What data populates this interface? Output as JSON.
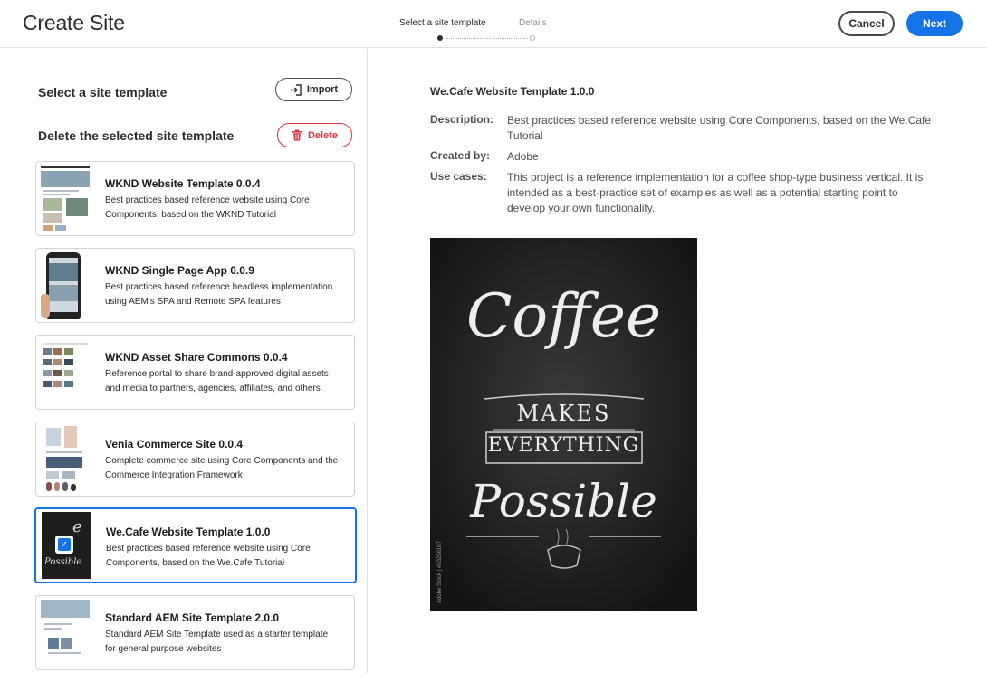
{
  "header": {
    "title": "Create Site",
    "steps": [
      {
        "label": "Select a site template",
        "active": true
      },
      {
        "label": "Details",
        "active": false
      }
    ],
    "cancel_label": "Cancel",
    "next_label": "Next"
  },
  "left": {
    "select_title": "Select a site template",
    "import_label": "Import",
    "delete_title": "Delete the selected site template",
    "delete_label": "Delete",
    "templates": [
      {
        "title": "WKND Website Template 0.0.4",
        "desc": "Best practices based reference website using Core Components, based on the WKND Tutorial",
        "selected": false
      },
      {
        "title": "WKND Single Page App 0.0.9",
        "desc": "Best practices based reference headless implementation using AEM's SPA and Remote SPA features",
        "selected": false
      },
      {
        "title": "WKND Asset Share Commons 0.0.4",
        "desc": "Reference portal to share brand-approved digital assets and media to partners, agencies, affiliates, and others",
        "selected": false
      },
      {
        "title": "Venia Commerce Site 0.0.4",
        "desc": "Complete commerce site using Core Components and the Commerce Integration Framework",
        "selected": false
      },
      {
        "title": "We.Cafe Website Template 1.0.0",
        "desc": "Best practices based reference website using Core Components, based on the We.Cafe Tutorial",
        "selected": true
      },
      {
        "title": "Standard AEM Site Template 2.0.0",
        "desc": "Standard AEM Site Template used as a starter template for general purpose websites",
        "selected": false
      }
    ]
  },
  "detail": {
    "title": "We.Cafe Website Template 1.0.0",
    "description_label": "Description:",
    "description": "Best practices based reference website using Core Components, based on the We.Cafe Tutorial",
    "created_by_label": "Created by:",
    "created_by": "Adobe",
    "use_cases_label": "Use cases:",
    "use_cases": "This project is a reference implementation for a coffee shop-type business vertical. It is intended as a best-practice set of examples as well as a potential starting point to develop your own functionality.",
    "preview": {
      "line1": "Coffee",
      "line2": "MAKES",
      "line3": "EVERYTHING",
      "line4": "Possible",
      "watermark": "Adobe Stock | #53256167"
    }
  },
  "colors": {
    "accent": "#1473e6",
    "delete": "#d7373f",
    "preview_bg": "#1c1c1c"
  }
}
